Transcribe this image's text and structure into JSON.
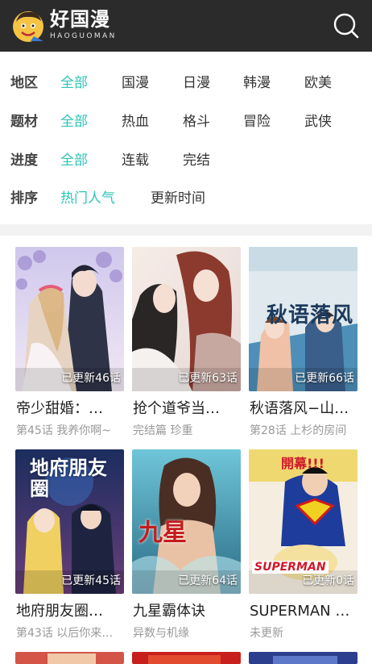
{
  "header": {
    "app_title": "好国漫",
    "app_subtitle": "HAOGUOMAN",
    "search_icon": "search-icon",
    "bg_color": "#2b2b2b"
  },
  "filters": [
    {
      "label": "地区",
      "options": [
        "全部",
        "国漫",
        "日漫",
        "韩漫",
        "欧美"
      ],
      "selected": "全部"
    },
    {
      "label": "题材",
      "options": [
        "全部",
        "热血",
        "格斗",
        "冒险",
        "武侠"
      ],
      "selected": "全部"
    },
    {
      "label": "进度",
      "options": [
        "全部",
        "连载",
        "完结"
      ],
      "selected": "全部"
    },
    {
      "label": "排序",
      "options": [
        "热门人气",
        "更新时间"
      ],
      "selected": "热门人气"
    }
  ],
  "accent_color": "#2ec4b6",
  "comics": [
    {
      "title": "帝少甜婚：…",
      "update": "已更新46话",
      "latest": "第45话 我养你啊~"
    },
    {
      "title": "抢个道爷当…",
      "update": "已更新63话",
      "latest": "完结篇 珍重"
    },
    {
      "title": "秋语落风−山…",
      "update": "已更新66话",
      "latest": "第28话 上杉的房间",
      "cover_text": "秋语落风"
    },
    {
      "title": "地府朋友圈…",
      "update": "已更新45话",
      "latest": "第43话 以后你来…",
      "cover_text": "地府朋友圈"
    },
    {
      "title": "九星霸体诀",
      "update": "已更新64话",
      "latest": "异数与机缘",
      "cover_text": "九星"
    },
    {
      "title": "SUPERMAN …",
      "update": "已更新0话",
      "latest": "未更新",
      "cover_text": "SUPERMAN",
      "cover_badge": "開幕!!!"
    }
  ]
}
